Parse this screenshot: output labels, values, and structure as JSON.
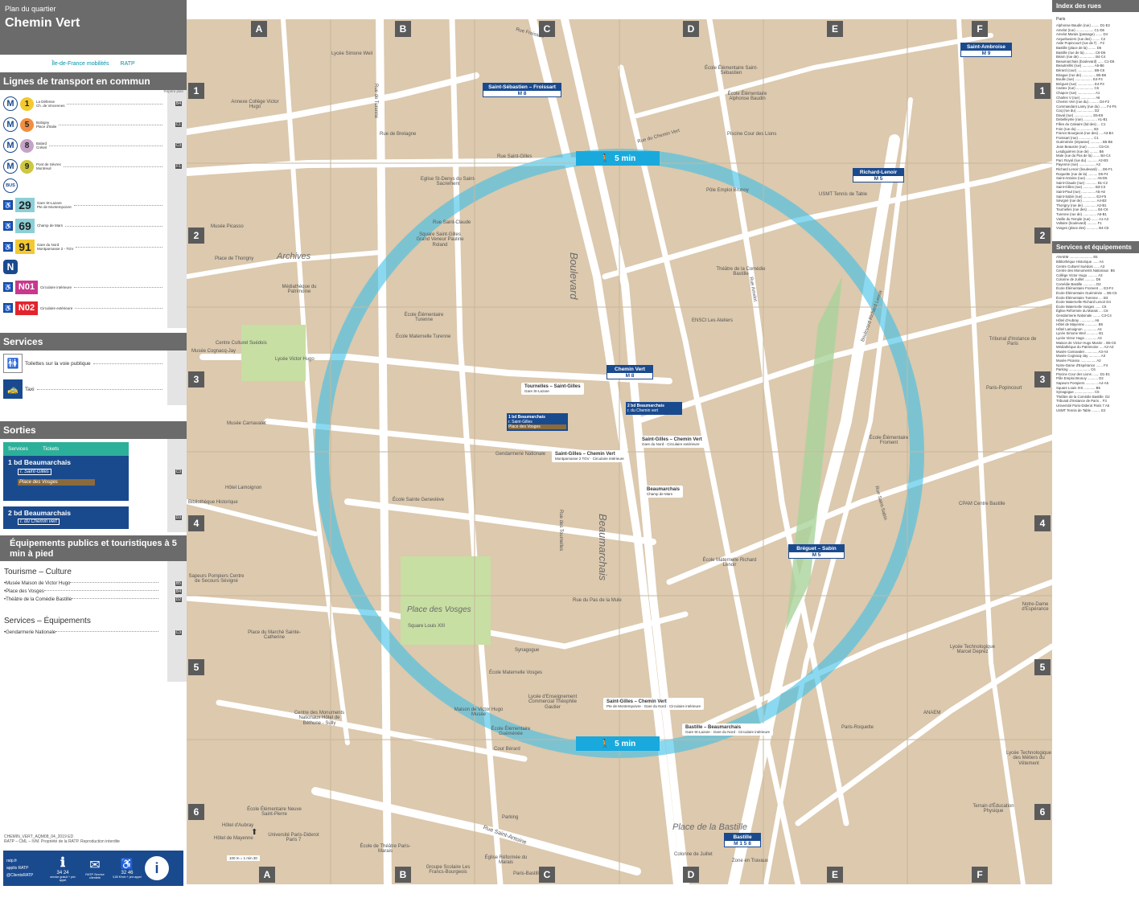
{
  "header": {
    "subtitle": "Plan du quartier",
    "title": "Chemin Vert"
  },
  "logos": [
    "Île-de-France mobilités",
    "RATP"
  ],
  "transport": {
    "heading": "Lignes de transport en commun",
    "col_label": "Repère plan",
    "metro": [
      {
        "line": "1",
        "color": "#f2c931",
        "desc1": "La Défense",
        "desc2": "Ch. de Vincennes",
        "ref": "B4"
      },
      {
        "line": "5",
        "color": "#f28e42",
        "desc1": "Bobigny",
        "desc2": "Place d'Italie",
        "ref": "C1"
      },
      {
        "line": "8",
        "color": "#c5a3c9",
        "desc1": "Balard",
        "desc2": "Créteil",
        "ref": "C3"
      },
      {
        "line": "9",
        "color": "#cdc83f",
        "desc1": "Pont de Sèvres",
        "desc2": "Montreuil",
        "ref": "F1"
      }
    ],
    "bus_label": "BUS",
    "bus": [
      {
        "line": "29",
        "color": "#8ccfd6",
        "desc1": "Gare St-Lazare",
        "desc2": "Pte de Montempoivre"
      },
      {
        "line": "69",
        "color": "#8ccfd6",
        "desc1": "Champ de Mars",
        "desc2": ""
      },
      {
        "line": "91",
        "color": "#f2c931",
        "desc1": "Gare du Nord",
        "desc2": "Montparnasse 2 - TGV"
      }
    ],
    "noctilien_label": "N",
    "noctilien": [
      {
        "line": "N01",
        "color": "#c8388c",
        "desc": "Circulaire intérieure"
      },
      {
        "line": "N02",
        "color": "#e3232c",
        "desc": "Circulaire extérieure"
      }
    ]
  },
  "services": {
    "heading": "Services",
    "items": [
      {
        "label": "Toilettes sur la voie publique",
        "icon": "toilet-icon"
      },
      {
        "label": "Taxi",
        "icon": "taxi-icon"
      }
    ]
  },
  "sorties": {
    "heading": "Sorties",
    "services_label": "Services",
    "tickets_label": "Tickets",
    "exits": [
      {
        "num": "1",
        "name": "bd Beaumarchais",
        "sub1": "r. Saint-Gilles",
        "sub2": "Place des Vosges",
        "ref": "C3"
      },
      {
        "num": "2",
        "name": "bd Beaumarchais",
        "sub1": "r. du Chemin vert",
        "sub2": "",
        "ref": "D3"
      }
    ]
  },
  "equipements": {
    "heading": "Équipements publics et touristiques à 5 min à pied",
    "tourism_heading": "Tourisme – Culture",
    "tourism": [
      {
        "label": "Musée Maison de Victor Hugo",
        "ref": "B5"
      },
      {
        "label": "Place des Vosges",
        "ref": "B4"
      },
      {
        "label": "Théâtre de la Comédie Bastille",
        "ref": "D2"
      }
    ],
    "services_heading": "Services – Équipements",
    "services": [
      {
        "label": "Gendarmerie Nationale",
        "ref": "C3"
      }
    ]
  },
  "footer": {
    "code": "CHEMIN_VERT_AQM08_04_2019 ED",
    "legal": "RATP – CML – IVM. Propriété de la RATP. Reproduction interdite",
    "links": [
      "ratp.fr",
      "applis RATP",
      "@ClientsRATP"
    ],
    "phone1": "34 24",
    "phone1_note": "service gratuit + prix appel",
    "service_client": "RATP Service clientèle",
    "phone2": "32 46",
    "phone2_note": "0,80 €/min + prix appel"
  },
  "map": {
    "col_labels": [
      "A",
      "B",
      "C",
      "D",
      "E",
      "F"
    ],
    "row_labels": [
      "1",
      "2",
      "3",
      "4",
      "5",
      "6"
    ],
    "walk_label": "5 min",
    "scale_label": "100 m = 1 min 30",
    "stations": [
      {
        "name": "Saint-Sébastien – Froissart",
        "lines": "M 8"
      },
      {
        "name": "Saint-Ambroise",
        "lines": "M 9"
      },
      {
        "name": "Richard-Lenoir",
        "lines": "M 5"
      },
      {
        "name": "Chemin Vert",
        "lines": "M 8"
      },
      {
        "name": "Bréguet – Sabin",
        "lines": "M 5"
      },
      {
        "name": "Bastille",
        "lines": "M 1 5 8"
      }
    ],
    "bus_stops": [
      {
        "name": "Tournelles – Saint-Gilles",
        "detail": "Gare St-Lazare"
      },
      {
        "name": "Saint-Gilles – Chemin Vert",
        "detail": "Montparnasse 2 TGV · Circulaire intérieure"
      },
      {
        "name": "Saint-Gilles – Chemin Vert",
        "detail": "Gare du Nord · Circulaire extérieure"
      },
      {
        "name": "Beaumarchais",
        "detail": "Champ de Mars"
      },
      {
        "name": "Saint-Gilles – Chemin Vert",
        "detail": "Pte de Montempoivre · Gare du Nord · Circulaire intérieure"
      },
      {
        "name": "Bastille – Beaumarchais",
        "detail": "Gare St-Lazare · Gare du Nord · Circulaire intérieure"
      }
    ],
    "exit_signs": [
      {
        "num": "1",
        "name": "bd Beaumarchais",
        "sub1": "r. Saint-Gilles",
        "sub2": "Place des Vosges"
      },
      {
        "num": "2",
        "name": "bd Beaumarchais",
        "sub1": "r. du Chemin vert"
      }
    ],
    "labels": [
      "Boulevard",
      "Beaumarchais",
      "Archives",
      "Place des Vosges",
      "Place de la Bastille",
      "Square Louis XIII",
      "Lycée Victor Hugo",
      "Annexe Collège Victor Hugo",
      "Lycée Simone Weil",
      "Musée Picasso",
      "Place de Thorigny",
      "Médiathèque du Patrimoine",
      "Square Saint-Gilles Grand Veneur Pauline Roland",
      "Eglise St-Denys du Saint-Sacrement",
      "École Élémentaire Turenne",
      "École Maternelle Turenne",
      "Centre Culturel Suédois",
      "Musée Cognacq-Jay",
      "Musée Carnavalet",
      "Hôtel Lamoignon",
      "Bibliothèque Historique",
      "Gendarmerie Nationale",
      "École Sainte Geneviève",
      "Sapeurs Pompiers Centre de Secours Sévigné",
      "Place du Marché Sainte-Catherine",
      "Centre des Monuments Nationaux Hôtel de Béthune - Sully",
      "Maison de Victor Hugo Musée",
      "École Maternelle Vosges",
      "Synagogue",
      "Lycée d'Enseignement Commercial Théophile Gautier",
      "École Élémentaire Guéménée",
      "Cour Bérard",
      "École Élémentaire Neuve Saint-Pierre",
      "Hôtel d'Aubray",
      "Hôtel de Mayenne",
      "Université Paris-Diderot Paris 7",
      "École de Théâtre Paris-Marais",
      "Église Réformée du Marais",
      "Groupe Scolaire Les Francs-Bourgeois",
      "Parking",
      "Paris-Bastille",
      "École Élémentaire Saint-Sébastien",
      "École Élémentaire Alphonse Baudin",
      "Piscine Cour des Lions",
      "Pôle Emploi Brunoy",
      "Théâtre de la Comédie Bastille",
      "ENSCI Les Ateliers",
      "USMT Tennis de Table",
      "Tribunal d'Instance de Paris",
      "Paris-Popincourt",
      "École Élémentaire Froment",
      "CPAM Centre Bastille",
      "École Maternelle Richard Lenoir",
      "Lycée Technologique Marcel Deprez",
      "Paris-Roquette",
      "ANAEM",
      "Lycée Technologique des Métiers du Vêtement",
      "Notre-Dame d'Espérance",
      "Terrain d'Éducation Physique",
      "Zone en Travaux",
      "Colonne de Juillet",
      "Rue Saint-Antoine",
      "Rue de Turenne",
      "Rue Saint-Gilles",
      "Rue du Pas de la Mule",
      "Rue des Tournelles",
      "Rue Saint-Claude",
      "Rue Amelot",
      "Boulevard Richard Lenoir",
      "Rue du Chemin Vert",
      "Rue Saint-Sabin",
      "Rue Froissart",
      "Rue de Bretagne"
    ]
  },
  "index": {
    "streets_heading": "Index des rues",
    "streets_city": "Paris",
    "streets": [
      "Alphonse Baudin (rue) ........ D1-E2",
      "Amelot (rue) .................. C1-D5",
      "Amelot Marais (passage) ....... D4",
      "Arquebusiers (rue des) ........ C2",
      "Asile Popincourt (rue de l') .. F2",
      "Bastille (place de la) ........ D6",
      "Bastille (rue de la) .......... C6-D6",
      "Béarn (rue de) ................ B4-C4",
      "Beaumarchais (boulevard) ...... C1-D6",
      "Beautreillis (rue) ............ A6-B6",
      "Bérard (cour) ................. B6-C6",
      "Birague (rue de) .............. B5-B6",
      "Boulle (rue) .................. E4-F4",
      "Bréguet (rue) ................. E4-F3",
      "Castex (rue) .................. C6",
      "Chapon (rue) .................. A1",
      "Charles V (rue) ............... A6",
      "Chemin Vert (rue du) .......... D4-F2",
      "Commandant Lamy (rue du) ...... F4-F5",
      "Coq (rue du) .................. D2",
      "Daval (rue) ................... E5-E6",
      "Debelleyme (rue) .............. A1-B1",
      "Filles du Calvaire (bd des) ... C1",
      "Foin (rue du) ................. B3",
      "Francs Bourgeois (rue des) .... A3-B4",
      "Froissart (rue) ............... C1",
      "Guéménée (impasse) ............ B5-B6",
      "Jean Beausire (rue) ........... C5-C6",
      "Lesdiguières (rue de) ......... B6",
      "Mule (rue du Pas de la) ....... B4-C4",
      "Parc Royal (rue du) ........... A2-B3",
      "Payenne (rue) ................. A3",
      "Richard Lenoir (boulevard) .... D6-F1",
      "Roquette (rue de la) .......... D5-F4",
      "Saint-Antoine (rue) ........... A5-D6",
      "Saint-Claude (rue) ............ B1-C2",
      "Saint-Gilles (rue) ............ B3-C3",
      "Saint-Paul (rue) .............. A5-A6",
      "Saint-Sabin (rue) ............. E3-F5",
      "Sévigné (rue de) .............. A4-B3",
      "Thorigny (rue de) ............. A2-B1",
      "Tournelles (rue des) .......... B4-C6",
      "Turenne (rue de) .............. A5-B1",
      "Vieille du Temple (rue) ....... A1-A3",
      "Voltaire (boulevard) .......... F1",
      "Vosges (place des) ............ B4-C5"
    ],
    "equip_heading": "Services et équipements",
    "equip": [
      "ANAEM ........................ E5",
      "Bibliothèque Historique ...... A4",
      "Centre Culturel Suédois ...... A3",
      "Centre des Monuments Nationaux  B5",
      "Collège Victor Hugo .......... A3",
      "Colonne de Juillet ........... D6",
      "Comédie Bastille ............. D2",
      "École Élémentaire Froment .... E3-F4",
      "École Élémentaire Guéménée ... B5-C5",
      "École Élémentaire Turenne .... B3",
      "École Maternelle Richard Lenoir D4",
      "École Maternelle Vosges ...... C5",
      "Église Réformée du Marais .... C6",
      "Gendarmerie Nationale ........ C3-C4",
      "Hôtel d'Aubray ............... A6",
      "Hôtel de Mayenne ............. B6",
      "Hôtel Lamoignon .............. A4",
      "Lycée Simone Weil ............ B1",
      "Lycée Victor Hugo ............ A3",
      "Maison de Victor Hugo Musée .. B5-C5",
      "Médiathèque du Patrimoine .... A2-A3",
      "Musée Carnavalet ............. A3-A4",
      "Musée Cognacq-Jay ............ A3",
      "Musée Picasso ................ A2",
      "Notre-Dame d'Espérance ....... F4",
      "Parking ...................... C6",
      "Piscine Cour des Lions ....... D1-E1",
      "Pôle Emploi Brunoy ........... D2",
      "Sapeurs Pompiers ............. A4-A5",
      "Square Louis XIII ............ B5",
      "Synagogue .................... C5",
      "Théâtre de la Comédie Bastille  D2",
      "Tribunal d'Instance de Paris .. F3",
      "Université Paris-Diderot Paris 7 A6",
      "USMT Tennis de Table ......... E2"
    ]
  }
}
